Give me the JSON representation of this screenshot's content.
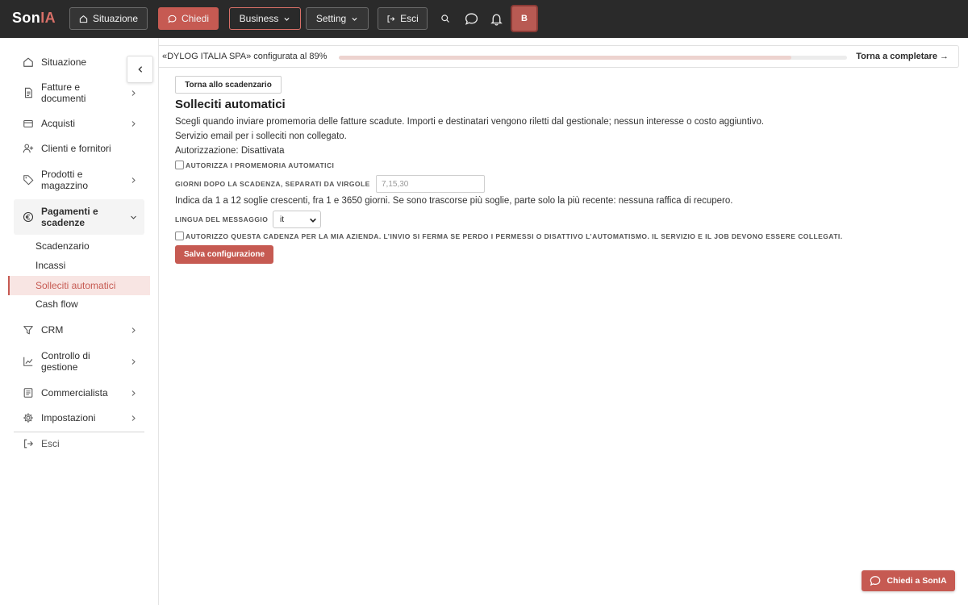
{
  "app": {
    "logo_prefix": "Son",
    "logo_suffix": "IA"
  },
  "topbar": {
    "situazione": "Situazione",
    "chiedi": "Chiedi",
    "business": "Business",
    "setting": "Setting",
    "esci": "Esci",
    "avatar": "B"
  },
  "sidebar": {
    "items": [
      {
        "label": "Situazione",
        "icon": "home-icon"
      },
      {
        "label": "Fatture e documenti",
        "icon": "document-icon"
      },
      {
        "label": "Acquisti",
        "icon": "wallet-icon"
      },
      {
        "label": "Clienti e fornitori",
        "icon": "user-plus-icon"
      },
      {
        "label": "Prodotti e magazzino",
        "icon": "tag-icon"
      },
      {
        "label": "Pagamenti e scadenze",
        "icon": "euro-icon"
      },
      {
        "label": "CRM",
        "icon": "funnel-icon"
      },
      {
        "label": "Controllo di gestione",
        "icon": "chart-icon"
      },
      {
        "label": "Commercialista",
        "icon": "ledger-icon"
      },
      {
        "label": "Impostazioni",
        "icon": "gear-icon"
      },
      {
        "label": "Esci",
        "icon": "logout-icon"
      }
    ],
    "sub_items": [
      "Scadenzario",
      "Incassi",
      "Solleciti automatici",
      "Cash flow"
    ]
  },
  "progress": {
    "text": "«DYLOG ITALIA SPA» configurata al 89%",
    "value": 0.89,
    "link": "Torna a completare →"
  },
  "main": {
    "back_button": "Torna allo scadenzario",
    "title": "Solleciti automatici",
    "description": "Scegli quando inviare promemoria delle fatture scadute. Importi e destinatari vengono riletti dal gestionale; nessun interesse o costo aggiuntivo.",
    "email_status": "Servizio email per i solleciti non collegato.",
    "authorization": "Autorizzazione: Disattivata",
    "authorize_label": "Autorizza i promemoria automatici",
    "days_label": "Giorni dopo la scadenza, separati da virgole",
    "days_placeholder": "7,15,30",
    "days_help": "Indica da 1 a 12 soglie crescenti, fra 1 e 3650 giorni. Se sono trascorse più soglie, parte solo la più recente: nessuna raffica di recupero.",
    "language_label": "Lingua del messaggio",
    "language_value": "it",
    "consent_label": "Autorizzo questa cadenza per la mia azienda. L’invio si ferma se perdo i permessi o disattivo l’automatismo. Il servizio e il job devono essere collegati.",
    "save_button": "Salva configurazione"
  },
  "fab": {
    "label": "Chiedi a SonIA"
  },
  "colors": {
    "accent": "#c65a52",
    "topbar": "#2a2a2a",
    "active_bg": "#f8e5e3"
  }
}
